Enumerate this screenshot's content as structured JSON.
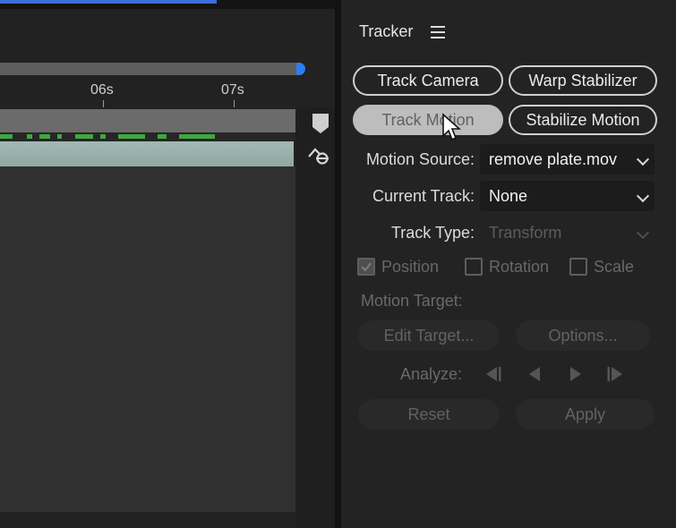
{
  "timeline": {
    "ticks": [
      {
        "label": "06s"
      },
      {
        "label": "07s"
      }
    ]
  },
  "tracker": {
    "title": "Tracker",
    "buttons": {
      "track_camera": "Track Camera",
      "warp_stabilizer": "Warp Stabilizer",
      "track_motion": "Track Motion",
      "stabilize_motion": "Stabilize Motion"
    },
    "motion_source": {
      "label": "Motion Source:",
      "value": "remove plate.mov"
    },
    "current_track": {
      "label": "Current Track:",
      "value": "None"
    },
    "track_type": {
      "label": "Track Type:",
      "value": "Transform"
    },
    "checkboxes": {
      "position": {
        "label": "Position",
        "checked": true
      },
      "rotation": {
        "label": "Rotation",
        "checked": false
      },
      "scale": {
        "label": "Scale",
        "checked": false
      }
    },
    "motion_target_label": "Motion Target:",
    "edit_target": "Edit Target...",
    "options": "Options...",
    "analyze_label": "Analyze:",
    "reset": "Reset",
    "apply": "Apply"
  },
  "colors": {
    "accent_blue": "#2d7cf0",
    "keyframe_green": "#3fa83f",
    "clip_teal": "#9cb2ad"
  }
}
